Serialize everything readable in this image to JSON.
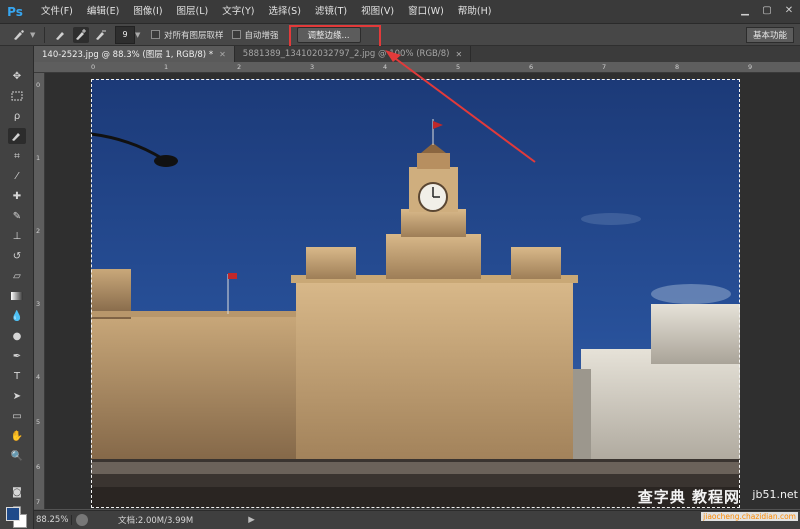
{
  "app": {
    "logo": "Ps"
  },
  "menu": [
    "文件(F)",
    "编辑(E)",
    "图像(I)",
    "图层(L)",
    "文字(Y)",
    "选择(S)",
    "滤镜(T)",
    "视图(V)",
    "窗口(W)",
    "帮助(H)"
  ],
  "window_controls": [
    "minimize-icon",
    "maximize-icon",
    "close-icon"
  ],
  "options": {
    "brush_size": "9",
    "sample_all_layers": "对所有图层取样",
    "auto_enhance": "自动增强",
    "refine_edge": "调整边缘...",
    "workspace": "基本功能"
  },
  "tabs": [
    {
      "label": "140-2523.jpg @ 88.3% (图层 1, RGB/8) *",
      "active": true
    },
    {
      "label": "5881389_134102032797_2.jpg @ 100% (RGB/8)",
      "active": false
    }
  ],
  "ruler_h": [
    "0",
    "1",
    "2",
    "3",
    "4",
    "5",
    "6",
    "7",
    "8",
    "9"
  ],
  "ruler_v": [
    "0",
    "1",
    "2",
    "3",
    "4",
    "5",
    "6",
    "7"
  ],
  "status": {
    "zoom": "88.25%",
    "doc": "文档:2.00M/3.99M"
  },
  "watermark": {
    "main": "查字典 教程网",
    "site": "jb51.net",
    "sub": "jiaocheng.chazidian.com"
  },
  "colors": {
    "accent_annotation": "#e23a3a",
    "foreground_color": "#1f4a8a",
    "background_color": "#ffffff"
  },
  "tools": [
    "move-tool-icon",
    "marquee-tool-icon",
    "lasso-tool-icon",
    "quick-selection-tool-icon",
    "crop-tool-icon",
    "eyedropper-tool-icon",
    "healing-brush-tool-icon",
    "brush-tool-icon",
    "clone-stamp-tool-icon",
    "history-brush-tool-icon",
    "eraser-tool-icon",
    "gradient-tool-icon",
    "blur-tool-icon",
    "dodge-tool-icon",
    "pen-tool-icon",
    "type-tool-icon",
    "path-selection-tool-icon",
    "shape-tool-icon",
    "hand-tool-icon",
    "zoom-tool-icon"
  ]
}
